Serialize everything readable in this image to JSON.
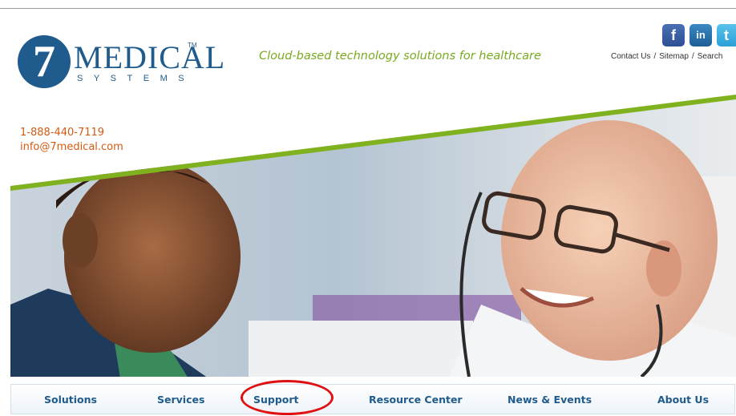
{
  "brand": {
    "logo_numeral": "7",
    "logo_word": "MEDICAL",
    "logo_tm": "TM",
    "logo_sub": "SYSTEMS"
  },
  "tagline": "Cloud-based technology solutions for healthcare",
  "social": [
    {
      "icon": "facebook-icon",
      "glyph": "f"
    },
    {
      "icon": "linkedin-icon",
      "glyph": "in"
    },
    {
      "icon": "twitter-icon",
      "glyph": "t"
    }
  ],
  "top_links": {
    "contact_us": "Contact Us",
    "separator": "/",
    "sitemap": "Sitemap",
    "search": "Search"
  },
  "contact": {
    "phone": "1-888-440-7119",
    "email": "info@7medical.com"
  },
  "nav": {
    "items": [
      {
        "label": "Solutions"
      },
      {
        "label": "Services"
      },
      {
        "label": "Support",
        "highlighted": true
      },
      {
        "label": "Resource Center"
      },
      {
        "label": "News & Events"
      },
      {
        "label": "About Us"
      }
    ]
  },
  "colors": {
    "brand_blue": "#1f5b8c",
    "tagline_green": "#79a91f",
    "contact_orange": "#d35b12",
    "highlight_red": "#e01010"
  }
}
